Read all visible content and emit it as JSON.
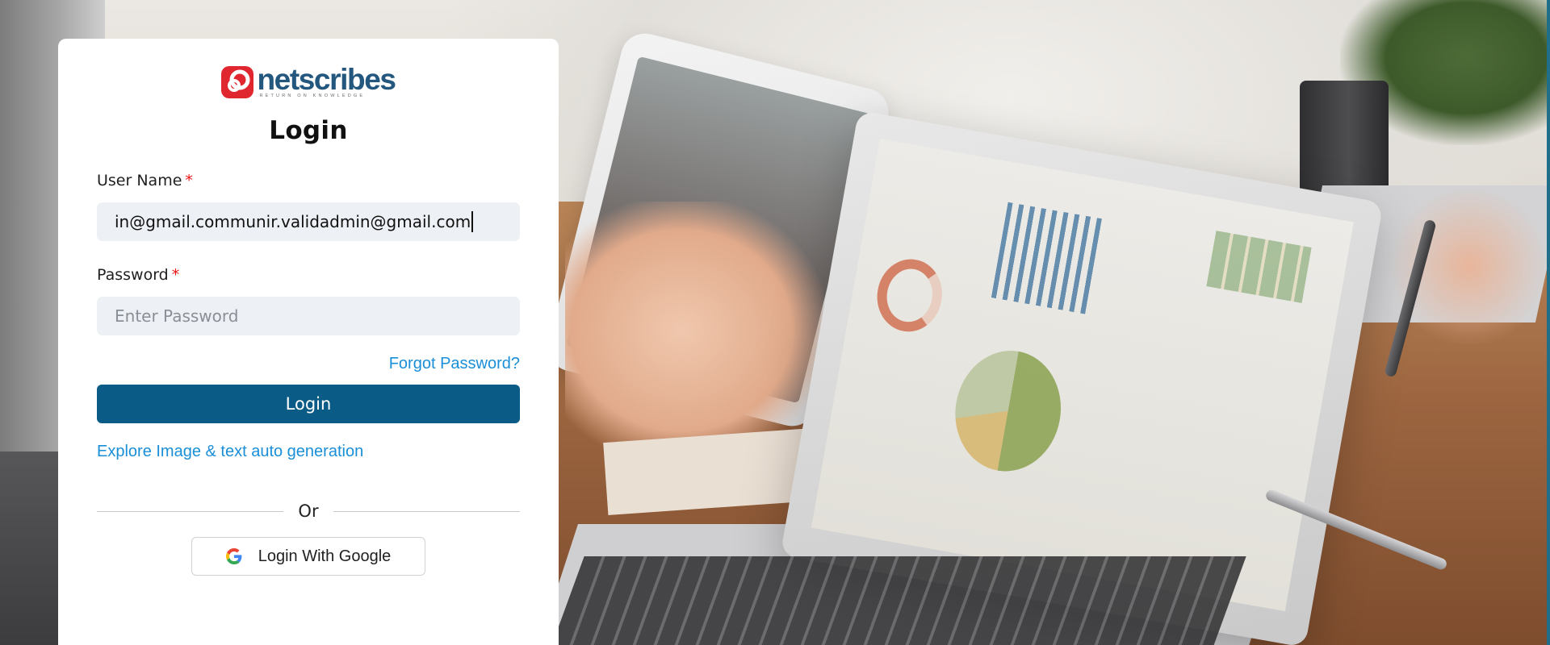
{
  "brand": {
    "name": "netscribes",
    "tagline": "RETURN ON KNOWLEDGE",
    "primary_color": "#23577e",
    "mark_color": "#e0262e"
  },
  "login": {
    "title": "Login",
    "username": {
      "label": "User Name",
      "required_marker": "*",
      "value": "in@gmail.communir.validadmin@gmail.com"
    },
    "password": {
      "label": "Password",
      "required_marker": "*",
      "placeholder": "Enter Password",
      "value": ""
    },
    "forgot_password": "Forgot Password?",
    "submit_label": "Login",
    "explore_link": "Explore Image & text auto generation",
    "divider_text": "Or",
    "google_label": "Login With Google"
  },
  "colors": {
    "button_bg": "#0a5b86",
    "link": "#1a8fd8",
    "input_bg": "#edf0f4",
    "required": "#ee1111"
  },
  "icons": {
    "logo": "netscribes-logo-icon",
    "google": "google-icon"
  }
}
